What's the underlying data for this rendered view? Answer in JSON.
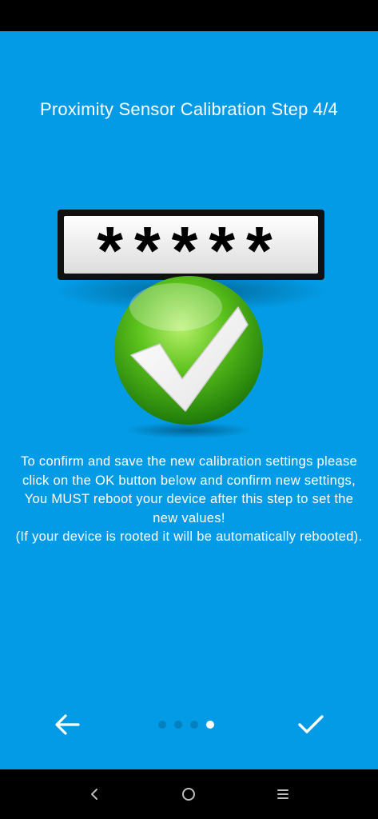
{
  "screen": {
    "title": "Proximity Sensor Calibration Step 4/4",
    "password_glyphs": "*****",
    "description_lines": [
      "To confirm and save the new calibration settings please click on the OK button below and confirm new settings,",
      "You MUST reboot your device after this step to set the new values!",
      "(If your device is rooted it will be automatically rebooted)."
    ]
  },
  "pager": {
    "total_pages": 4,
    "current_page": 4
  },
  "icons": {
    "back": "arrow-left-icon",
    "done": "checkmark-icon",
    "hero": "green-check-badge-icon",
    "nav_back": "chevron-left-icon",
    "nav_home": "circle-home-icon",
    "nav_menu": "hamburger-menu-icon"
  },
  "colors": {
    "background": "#039be5",
    "text": "#ffffff",
    "dot_active": "#ffffff",
    "dot_inactive": "#0281be",
    "check_green": "#4caf18",
    "system_bar": "#000000"
  }
}
